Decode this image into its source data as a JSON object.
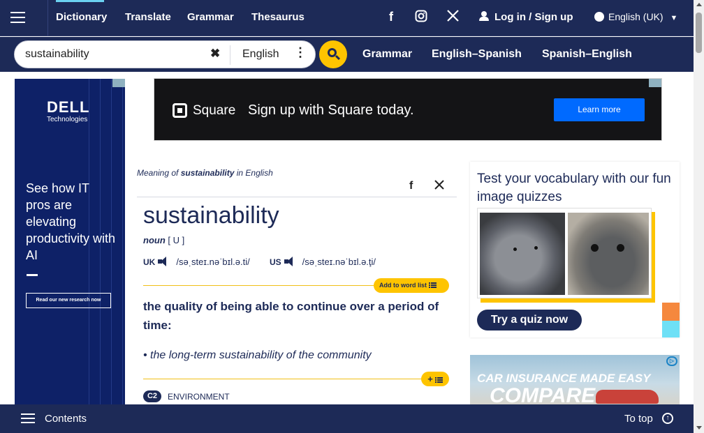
{
  "nav": {
    "links": [
      "Dictionary",
      "Translate",
      "Grammar",
      "Thesaurus"
    ],
    "social_icons": [
      "facebook-icon",
      "instagram-icon",
      "x-icon"
    ],
    "login": "Log in / Sign up",
    "language": "English (UK)"
  },
  "search": {
    "value": "sustainability",
    "dictionary": "English",
    "quicklinks": [
      "Grammar",
      "English–Spanish",
      "Spanish–English"
    ]
  },
  "left_ad": {
    "brand": "DELL",
    "brand_sub": "Technologies",
    "headline": "See how IT pros are elevating productivity with AI",
    "cta": "Read our new research now"
  },
  "top_ad": {
    "brand": "Square",
    "headline": "Sign up with Square today.",
    "cta": "Learn more"
  },
  "entry": {
    "meaning_prefix": "Meaning of ",
    "meaning_word": "sustainability",
    "meaning_suffix": " in English",
    "headword": "sustainability",
    "pos": "noun",
    "grammar": "[ U ]",
    "uk_label": "UK",
    "uk_ipa": "/səˌsteɪ.nəˈbɪl.ə.ti/",
    "us_label": "US",
    "us_ipa": "/səˌsteɪ.nəˈbɪl.ə.ţi/",
    "add_to_list": "Add to word list",
    "definition": "the quality of being able to continue over a period of time:",
    "example": "the long-term sustainability of the community",
    "level": "C2",
    "topic": "ENVIRONMENT"
  },
  "quiz": {
    "title": "Test your vocabulary with our fun image quizzes",
    "button": "Try a quiz now"
  },
  "car_ad": {
    "line1": "CAR INSURANCE MADE EASY",
    "line2": "COMPARE"
  },
  "bottom": {
    "contents": "Contents",
    "to_top": "To top"
  },
  "colors": {
    "navy": "#1d2a57",
    "accent": "#fec400",
    "active_tab": "#6bd1f0"
  }
}
